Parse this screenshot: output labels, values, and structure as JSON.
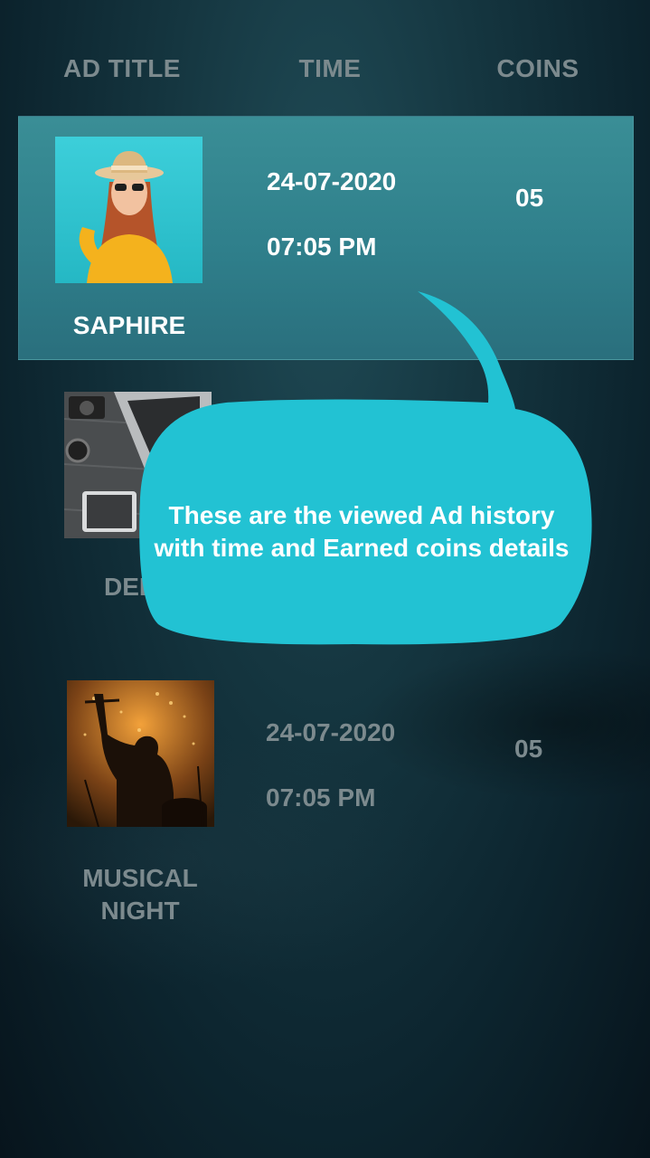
{
  "header": {
    "col_title": "AD TITLE",
    "col_time": "TIME",
    "col_coins": "COINS"
  },
  "rows": [
    {
      "title": "SAPHIRE",
      "date": "24-07-2020",
      "time": "07:05 PM",
      "coins": "05",
      "selected": true,
      "thumb": "woman-hat-photo"
    },
    {
      "title": "DEL",
      "date": "",
      "time": "",
      "coins": "",
      "selected": false,
      "thumb": "desk-laptop-photo"
    },
    {
      "title": "MUSICAL NIGHT",
      "date": "24-07-2020",
      "time": "07:05 PM",
      "coins": "05",
      "selected": false,
      "thumb": "concert-photo"
    }
  ],
  "tooltip": {
    "text": "These are the viewed Ad history with time and Earned coins details"
  },
  "colors": {
    "accent": "#22c2d3",
    "selected_row": "#2f7f8b",
    "muted_text": "#7c8a8e"
  }
}
